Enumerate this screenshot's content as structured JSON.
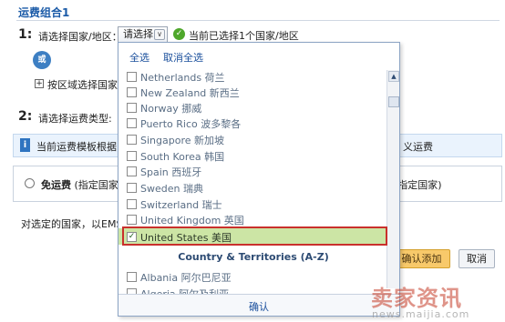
{
  "page": {
    "section_title": "运费组合1",
    "step1": {
      "num": "1:",
      "label": "请选择国家/地区："
    },
    "select": {
      "value": "请选择",
      "arrow": "∨"
    },
    "chosen_text": "当前已选择1个国家/地区",
    "or_label": "或",
    "region_label": "按区域选择国家",
    "step2": {
      "num": "2:",
      "label": "请选择运费类型:"
    },
    "info_left": "当前运费模板根据",
    "info_right": "义运费",
    "free_shipping": {
      "label": "免运费",
      "desc": "(指定国家",
      "right": "(指定国家)"
    },
    "bottom_text": "对选定的国家，以EMS",
    "buttons": {
      "confirm": "确认添加",
      "cancel": "取消"
    }
  },
  "dropdown": {
    "select_all": "全选",
    "cancel_all": "取消全选",
    "countries": [
      {
        "name": "Netherlands 荷兰",
        "checked": false
      },
      {
        "name": "New Zealand 新西兰",
        "checked": false
      },
      {
        "name": "Norway 挪威",
        "checked": false
      },
      {
        "name": "Puerto Rico 波多黎各",
        "checked": false
      },
      {
        "name": "Singapore 新加坡",
        "checked": false
      },
      {
        "name": "South Korea 韩国",
        "checked": false
      },
      {
        "name": "Spain 西班牙",
        "checked": false
      },
      {
        "name": "Sweden 瑞典",
        "checked": false
      },
      {
        "name": "Switzerland 瑞士",
        "checked": false
      },
      {
        "name": "United Kingdom 英国",
        "checked": false
      },
      {
        "name": "United States 美国",
        "checked": true
      }
    ],
    "group_header": "Country & Territories (A-Z)",
    "countries_az": [
      {
        "name": "Albania 阿尔巴尼亚",
        "checked": false
      },
      {
        "name": "Algeria 阿尔及利亚",
        "checked": false
      }
    ],
    "confirm": "确认"
  },
  "watermark": {
    "main": "卖家资讯",
    "sub": "news.maijia.com"
  },
  "colors": {
    "accent": "#1a5aa7",
    "selected_row": "#cce5a5",
    "highlight_frame": "#c9302c",
    "confirm_button": "#f8c96a"
  }
}
